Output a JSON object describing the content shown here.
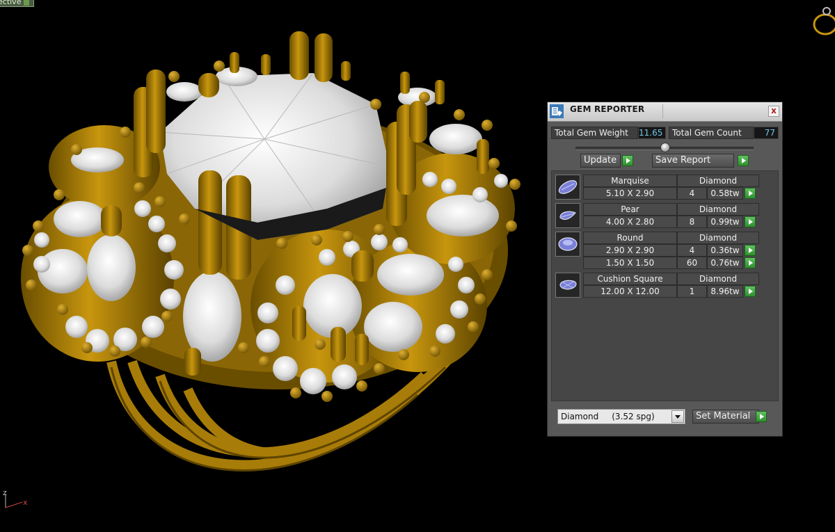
{
  "viewport": {
    "label": "ective",
    "axis_z": "z",
    "axis_x": "x"
  },
  "panel": {
    "title": "GEM REPORTER",
    "close": "x",
    "total_weight_label": "Total Gem Weight",
    "total_weight_value": "11.65",
    "total_count_label": "Total Gem Count",
    "total_count_value": "77",
    "update_label": "Update",
    "save_report_label": "Save Report",
    "gems": [
      {
        "shape": "Marquise",
        "material": "Diamond",
        "sizes": [
          {
            "size": "5.10 X 2.90",
            "count": "4",
            "weight": "0.58tw"
          }
        ]
      },
      {
        "shape": "Pear",
        "material": "Diamond",
        "sizes": [
          {
            "size": "4.00 X 2.80",
            "count": "8",
            "weight": "0.99tw"
          }
        ]
      },
      {
        "shape": "Round",
        "material": "Diamond",
        "sizes": [
          {
            "size": "2.90 X 2.90",
            "count": "4",
            "weight": "0.36tw"
          },
          {
            "size": "1.50 X 1.50",
            "count": "60",
            "weight": "0.76tw"
          }
        ]
      },
      {
        "shape": "Cushion Square",
        "material": "Diamond",
        "sizes": [
          {
            "size": "12.00 X 12.00",
            "count": "1",
            "weight": "8.96tw"
          }
        ]
      }
    ],
    "material_select": "Diamond     (3.52 spg)",
    "set_material_label": "Set Material"
  }
}
